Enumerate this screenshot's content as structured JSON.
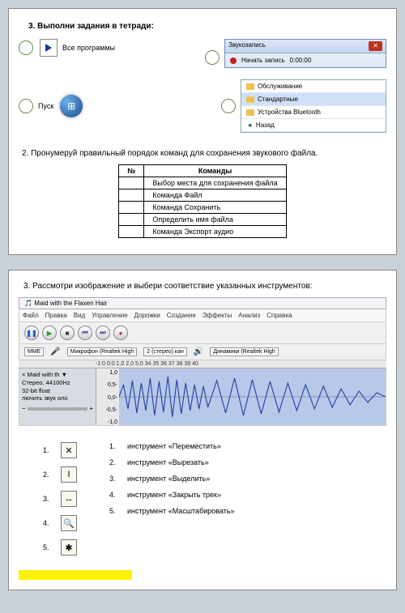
{
  "page1": {
    "heading": "3.  Выполни задания в тетради:",
    "all_programs": "Все программы",
    "start": "Пуск",
    "recorder": {
      "title": "Звукозапись",
      "button": "Начать запись",
      "time": "0:00:00"
    },
    "menu": {
      "items": [
        "Обслуживание",
        "Стандартные",
        "Устройства Bluetooth"
      ],
      "back": "Назад"
    },
    "task2": "2.   Пронумеруй правильный порядок команд для сохранения звукового файла.",
    "table": {
      "h1": "№",
      "h2": "Команды",
      "rows": [
        "Выбор места для сохранения файла",
        "Команда Файл",
        "Команда Сохранить",
        "Определить имя файла",
        "Команда Экспорт аудио"
      ]
    }
  },
  "page2": {
    "heading": "3. Рассмотри изображение и выбери соответствие указанных инструментов:",
    "app_title": "Maid with the Flaxen Hair",
    "menu": [
      "Файл",
      "Правка",
      "Вид",
      "Управление",
      "Дорожки",
      "Создание",
      "Эффекты",
      "Анализ",
      "Справка"
    ],
    "drops": {
      "host": "MME",
      "mic": "Микрофон (Realtek High",
      "ch": "2 (стерео) кан",
      "spk": "Динамики (Realtek High"
    },
    "ruler": "-1:0   0:0   1,0   2,0   5,0   34   35   36   37   38   39   40",
    "track": {
      "name": "× Maid with th ▼",
      "rate": "Стерео, 44100Hz",
      "bits": "32-bit float",
      "extra": "лючить звук оло"
    },
    "scale": [
      "1,0",
      "0,5-",
      "0,0-",
      "-0,5-",
      "-1,0"
    ],
    "left": [
      {
        "n": "1.",
        "sym": "✕"
      },
      {
        "n": "2.",
        "sym": "I"
      },
      {
        "n": "3.",
        "sym": "↔"
      },
      {
        "n": "4.",
        "sym": "🔍"
      },
      {
        "n": "5.",
        "sym": "✱"
      }
    ],
    "right": [
      {
        "n": "1.",
        "t": "инструмент «Переместить»"
      },
      {
        "n": "2.",
        "t": "инструмент «Вырезать»"
      },
      {
        "n": "3.",
        "t": "инструмент «Выделить»"
      },
      {
        "n": "4.",
        "t": "инструмент «Закрыть трек»"
      },
      {
        "n": "5.",
        "t": "инструмент «Масштабировать»"
      }
    ]
  }
}
